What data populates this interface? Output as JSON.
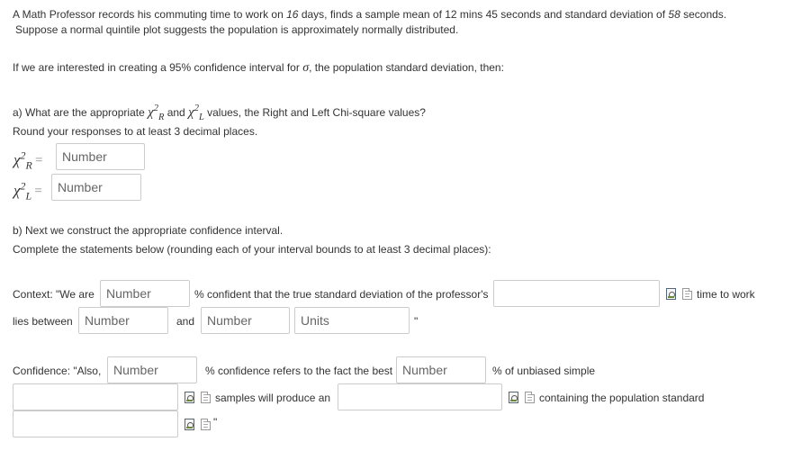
{
  "problem": {
    "line1_pre": "A Math Professor records his commuting time to work on ",
    "days": "16",
    "line1_mid": " days, finds a sample mean of 12 mins 45 seconds and standard deviation of ",
    "sd_value": "58",
    "line1_post": " seconds.",
    "line2": "Suppose a normal quintile plot suggests the population is approximately normally distributed.",
    "line3_pre": "If we are interested in creating a 95% confidence interval for ",
    "sigma": "σ",
    "line3_post": ", the population standard deviation, then:"
  },
  "part_a": {
    "q_pre": "a) What are the appropriate ",
    "q_and": " and ",
    "q_post": " values, the Right and Left Chi-square values?",
    "round_note": "Round your responses to at least 3 decimal places.",
    "chi_symbol": "χ",
    "sup_two": "2",
    "sub_r": "R",
    "sub_l": "L",
    "equals": "=",
    "right_placeholder": "Number",
    "left_placeholder": "Number"
  },
  "part_b": {
    "line1": "b) Next we construct the appropriate confidence interval.",
    "line2": "Complete the statements below (rounding each of your interval bounds to at least 3 decimal places):",
    "context_pre": "Context: \"We are",
    "context_pct_placeholder": "Number",
    "context_mid": "% confident that the true standard deviation of the professor's",
    "context_after_box": "time to work",
    "lies_between": "lies between",
    "lower_placeholder": "Number",
    "and_text": "and",
    "upper_placeholder": "Number",
    "units_placeholder": "Units",
    "close_quote": "\"",
    "conf_pre": "Confidence: \"Also,",
    "conf_pct_placeholder": "Number",
    "conf_mid": "% confidence refers to the fact the best",
    "conf_best_placeholder": "Number",
    "conf_post": "% of unbiased simple",
    "samples_text": "samples will produce an",
    "containing_text": "containing the population standard",
    "end_quote": "\""
  }
}
